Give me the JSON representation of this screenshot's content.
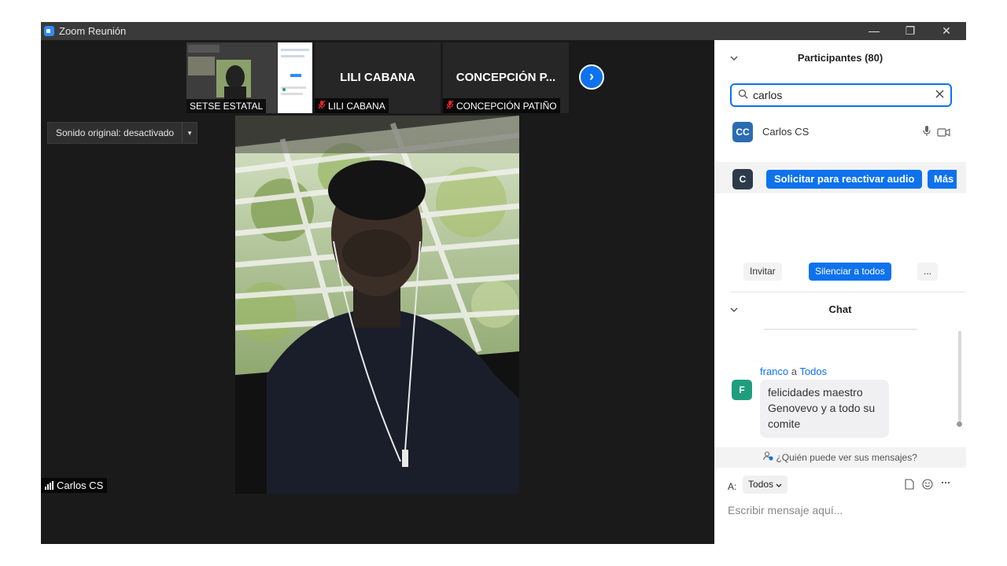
{
  "window": {
    "title": "Zoom Reunión",
    "minimize": "—",
    "restore": "❐",
    "close": "✕"
  },
  "thumbnails": [
    {
      "label": "SETSE ESTATAL",
      "muted": false,
      "name": ""
    },
    {
      "label": "LILI CABANA",
      "muted": true,
      "name": "LILI CABANA"
    },
    {
      "label": "CONCEPCIÓN PATIÑO",
      "muted": true,
      "name": "CONCEPCIÓN  P..."
    }
  ],
  "next_icon": "›",
  "sound": {
    "label": "Sonido original: desactivado",
    "arrow": "▾"
  },
  "speaker": {
    "name": "Carlos CS"
  },
  "participants": {
    "title": "Participantes (80)",
    "search_value": "carlos",
    "list": [
      {
        "initials": "CC",
        "name": "Carlos CS",
        "avatar_color": "#2b6cb0"
      },
      {
        "initials": "C",
        "avatar_color": "#2d3a4a",
        "request_label": "Solicitar para reactivar audio",
        "more_label": "Más"
      }
    ],
    "actions": {
      "invite": "Invitar",
      "mute_all": "Silenciar a todos",
      "more": "..."
    }
  },
  "chat": {
    "title": "Chat",
    "messages": [
      {
        "sender": "franco",
        "connector": "a",
        "recipient": "Todos",
        "avatar": "F",
        "avatar_color": "#1f9e7d",
        "text": "felicidades maestro Genovevo y a todo su comite"
      }
    ],
    "who_can_see": "¿Quién puede ver sus mensajes?",
    "to_label": "A:",
    "to_value": "Todos",
    "placeholder": "Escribir mensaje aquí..."
  }
}
